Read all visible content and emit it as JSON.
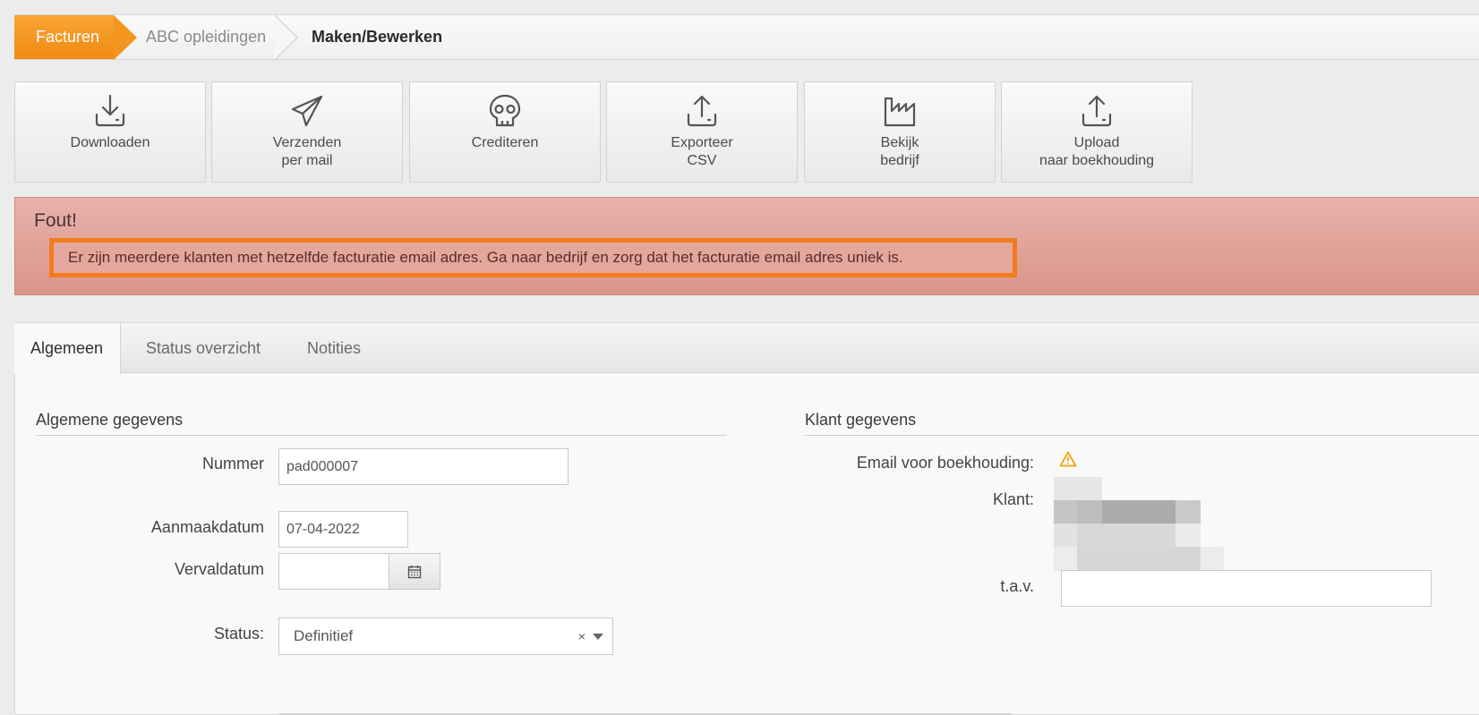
{
  "breadcrumb": {
    "items": [
      "Facturen",
      "ABC opleidingen",
      "Maken/Bewerken"
    ]
  },
  "toolbar": {
    "buttons": [
      {
        "line1": "Downloaden",
        "line2": "",
        "icon": "download-icon"
      },
      {
        "line1": "Verzenden",
        "line2": "per mail",
        "icon": "paper-plane-icon"
      },
      {
        "line1": "Crediteren",
        "line2": "",
        "icon": "skull-icon"
      },
      {
        "line1": "Exporteer",
        "line2": "CSV",
        "icon": "upload-tray-icon"
      },
      {
        "line1": "Bekijk",
        "line2": "bedrijf",
        "icon": "factory-icon"
      },
      {
        "line1": "Upload",
        "line2": "naar boekhouding",
        "icon": "upload-tray-icon"
      }
    ]
  },
  "alert": {
    "title": "Fout!",
    "message": "Er zijn meerdere klanten met hetzelfde facturatie email adres. Ga naar bedrijf en zorg dat het facturatie email adres uniek is."
  },
  "tabs": [
    "Algemeen",
    "Status overzicht",
    "Notities"
  ],
  "general": {
    "title": "Algemene gegevens",
    "nummer_label": "Nummer",
    "nummer_value": "pad000007",
    "aanmaak_label": "Aanmaakdatum",
    "aanmaak_value": "07-04-2022",
    "verval_label": "Vervaldatum",
    "verval_value": "",
    "status_label": "Status:",
    "status_value": "Definitief",
    "status_clear": "×"
  },
  "client": {
    "title": "Klant gegevens",
    "email_label": "Email voor boekhouding:",
    "klant_label": "Klant:",
    "tav_label": "t.a.v.",
    "tav_value": ""
  },
  "colors": {
    "accent": "#f08a12",
    "alert_bg": "#dfa398",
    "alert_border": "#f07c1c",
    "warning": "#f0a30a"
  }
}
